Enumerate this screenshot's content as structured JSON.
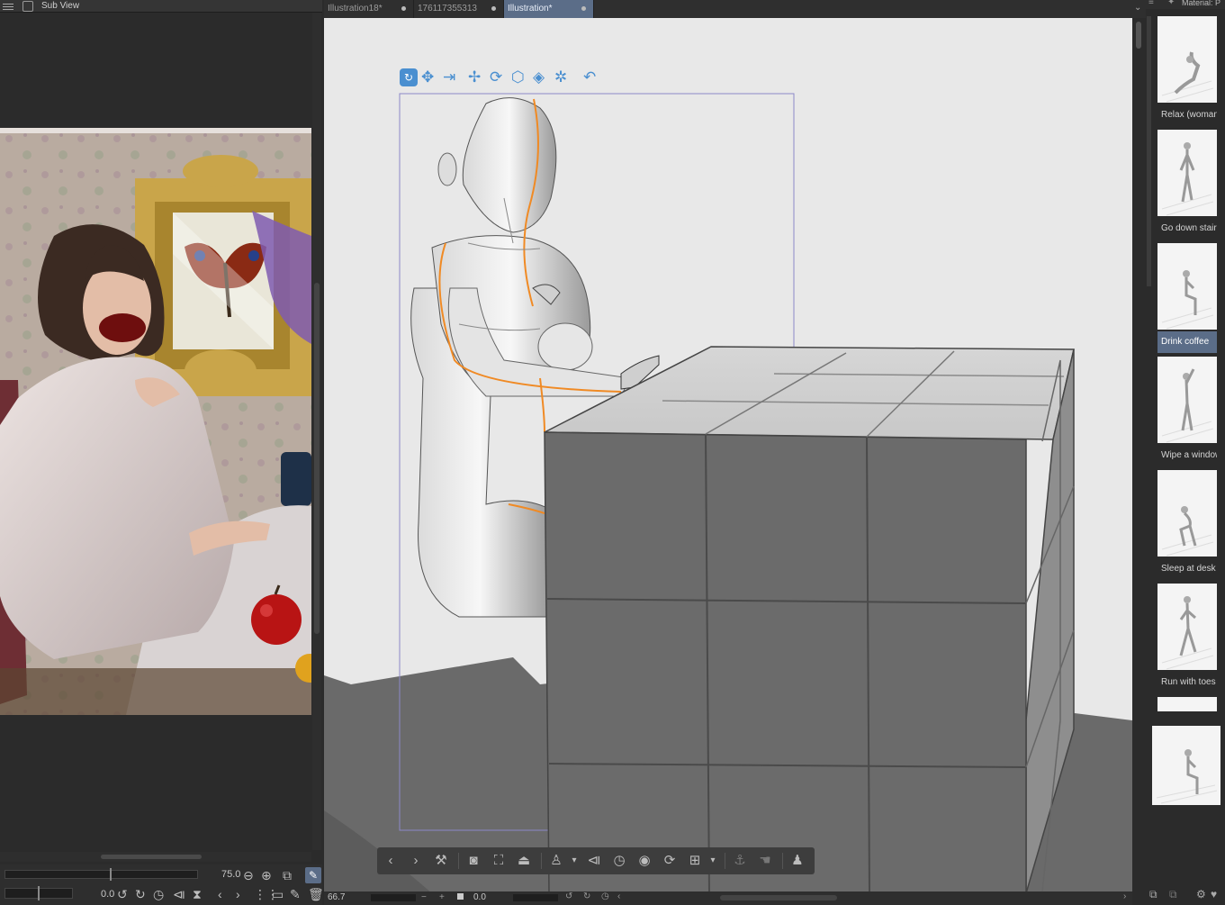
{
  "subview": {
    "title": "Sub View",
    "zoom_value": "75.0",
    "rotation_value": "0.0"
  },
  "tabs": [
    {
      "label": "Illustration18*"
    },
    {
      "label": "176117355313"
    },
    {
      "label": "Illustration*"
    }
  ],
  "canvas_status": {
    "zoom": "66.7",
    "angle": "0.0"
  },
  "material": {
    "title": "Material: P",
    "items": [
      {
        "label": "Relax (woman)"
      },
      {
        "label": "Go down stairs"
      },
      {
        "label": "Drink coffee"
      },
      {
        "label": "Wipe a window"
      },
      {
        "label": "Sleep at desk"
      },
      {
        "label": "Run with toes r"
      }
    ]
  },
  "icons": {
    "object_launcher": [
      "rotate-camera-icon",
      "pan-camera-icon",
      "dolly-camera-icon",
      "move-icon",
      "rotate-icon",
      "rotate-plane-icon",
      "rotate-plane-2-icon",
      "rotate-plane-3-icon",
      "snap-icon"
    ],
    "object_toolbar": [
      "prev-icon",
      "next-icon",
      "wrench-icon",
      "camera-icon",
      "fit-icon",
      "ground-icon",
      "pose-icon",
      "flip-icon",
      "reset-pose-icon",
      "save-pose-icon",
      "rotate-icon",
      "lock-icon",
      "anchor-icon",
      "hand-icon",
      "figure-icon"
    ]
  },
  "colors": {
    "active_tab": "#5b6d88",
    "canvas_bg": "#e8e8e8",
    "icon_blue": "#4a8fd0",
    "joint_orange": "#f08a24"
  }
}
